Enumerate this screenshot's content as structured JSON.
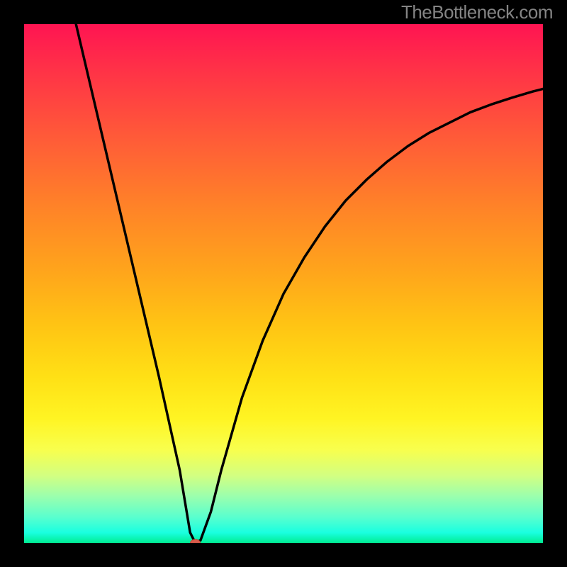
{
  "watermark": "TheBottleneck.com",
  "chart_data": {
    "type": "line",
    "title": "",
    "xlabel": "",
    "ylabel": "",
    "xlim": [
      0,
      100
    ],
    "ylim": [
      0,
      100
    ],
    "grid": false,
    "legend": false,
    "series": [
      {
        "name": "bottleneck-curve",
        "color": "#000000",
        "x": [
          10,
          14,
          18,
          22,
          26,
          30,
          31,
          32,
          33,
          34,
          36,
          38,
          42,
          46,
          50,
          54,
          58,
          62,
          66,
          70,
          74,
          78,
          82,
          86,
          90,
          94,
          98,
          100
        ],
        "y": [
          100,
          83,
          66,
          49,
          32,
          14,
          8,
          2,
          0,
          0.5,
          6,
          14,
          28,
          39,
          48,
          55,
          61,
          66,
          70,
          73.5,
          76.5,
          79,
          81,
          83,
          84.5,
          85.8,
          87,
          87.5
        ]
      }
    ],
    "markers": [
      {
        "name": "optimal-point",
        "x": 33,
        "y": 0,
        "color": "#d85a4a",
        "size": 7
      }
    ],
    "colors": {
      "gradient_top": "#ff1452",
      "gradient_mid": "#ffe015",
      "gradient_bottom": "#00ed94",
      "curve": "#000000",
      "marker": "#d85a4a",
      "frame": "#000000"
    }
  }
}
